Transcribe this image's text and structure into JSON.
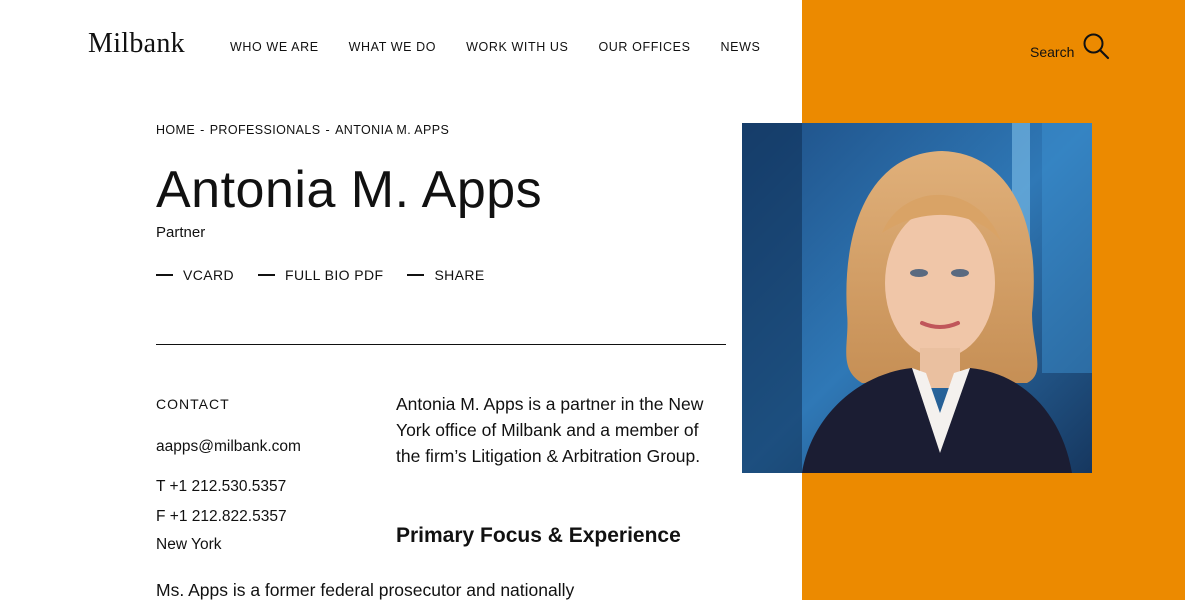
{
  "header": {
    "logo": "Milbank",
    "nav": [
      "WHO WE ARE",
      "WHAT WE DO",
      "WORK WITH US",
      "OUR OFFICES",
      "NEWS"
    ],
    "search_label": "Search"
  },
  "breadcrumb": {
    "items": [
      "HOME",
      "PROFESSIONALS",
      "ANTONIA M. APPS"
    ],
    "separator": "-"
  },
  "profile": {
    "name": "Antonia M. Apps",
    "title": "Partner",
    "actions": [
      "VCARD",
      "FULL BIO PDF",
      "SHARE"
    ]
  },
  "contact": {
    "heading": "CONTACT",
    "email": "aapps@milbank.com",
    "phone": "T +1 212.530.5357",
    "fax": "F +1 212.822.5357",
    "city": "New York"
  },
  "bio": {
    "intro": "Antonia M. Apps is a partner in the New York office of Milbank and a member of the firm’s Litigation & Arbitration Group.",
    "focus_heading": "Primary Focus & Experience",
    "first_line": "Ms. Apps is a former federal prosecutor and nationally"
  },
  "colors": {
    "accent": "#ec8a00",
    "text": "#111111"
  }
}
